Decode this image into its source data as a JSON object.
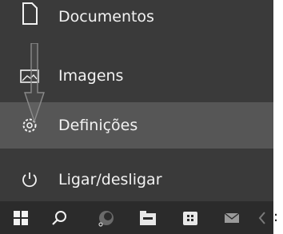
{
  "menu": {
    "items": [
      {
        "label": "Documentos",
        "icon": "document-icon"
      },
      {
        "label": "Imagens",
        "icon": "image-icon"
      },
      {
        "label": "Definições",
        "icon": "gear-icon",
        "highlighted": true
      },
      {
        "label": "Ligar/desligar",
        "icon": "power-icon"
      }
    ]
  },
  "annotation": {
    "arrow_icon": "down-arrow-icon"
  },
  "taskbar": {
    "icons": [
      "windows-start-icon",
      "search-icon",
      "browser-icon",
      "file-explorer-icon",
      "store-icon",
      "mail-icon",
      "partial-icon"
    ]
  },
  "trailing_text": ":",
  "colors": {
    "panel": "#3a3a3a",
    "highlight": "#565656",
    "taskbar": "#2b2b2b",
    "text": "#f2f2f2"
  }
}
